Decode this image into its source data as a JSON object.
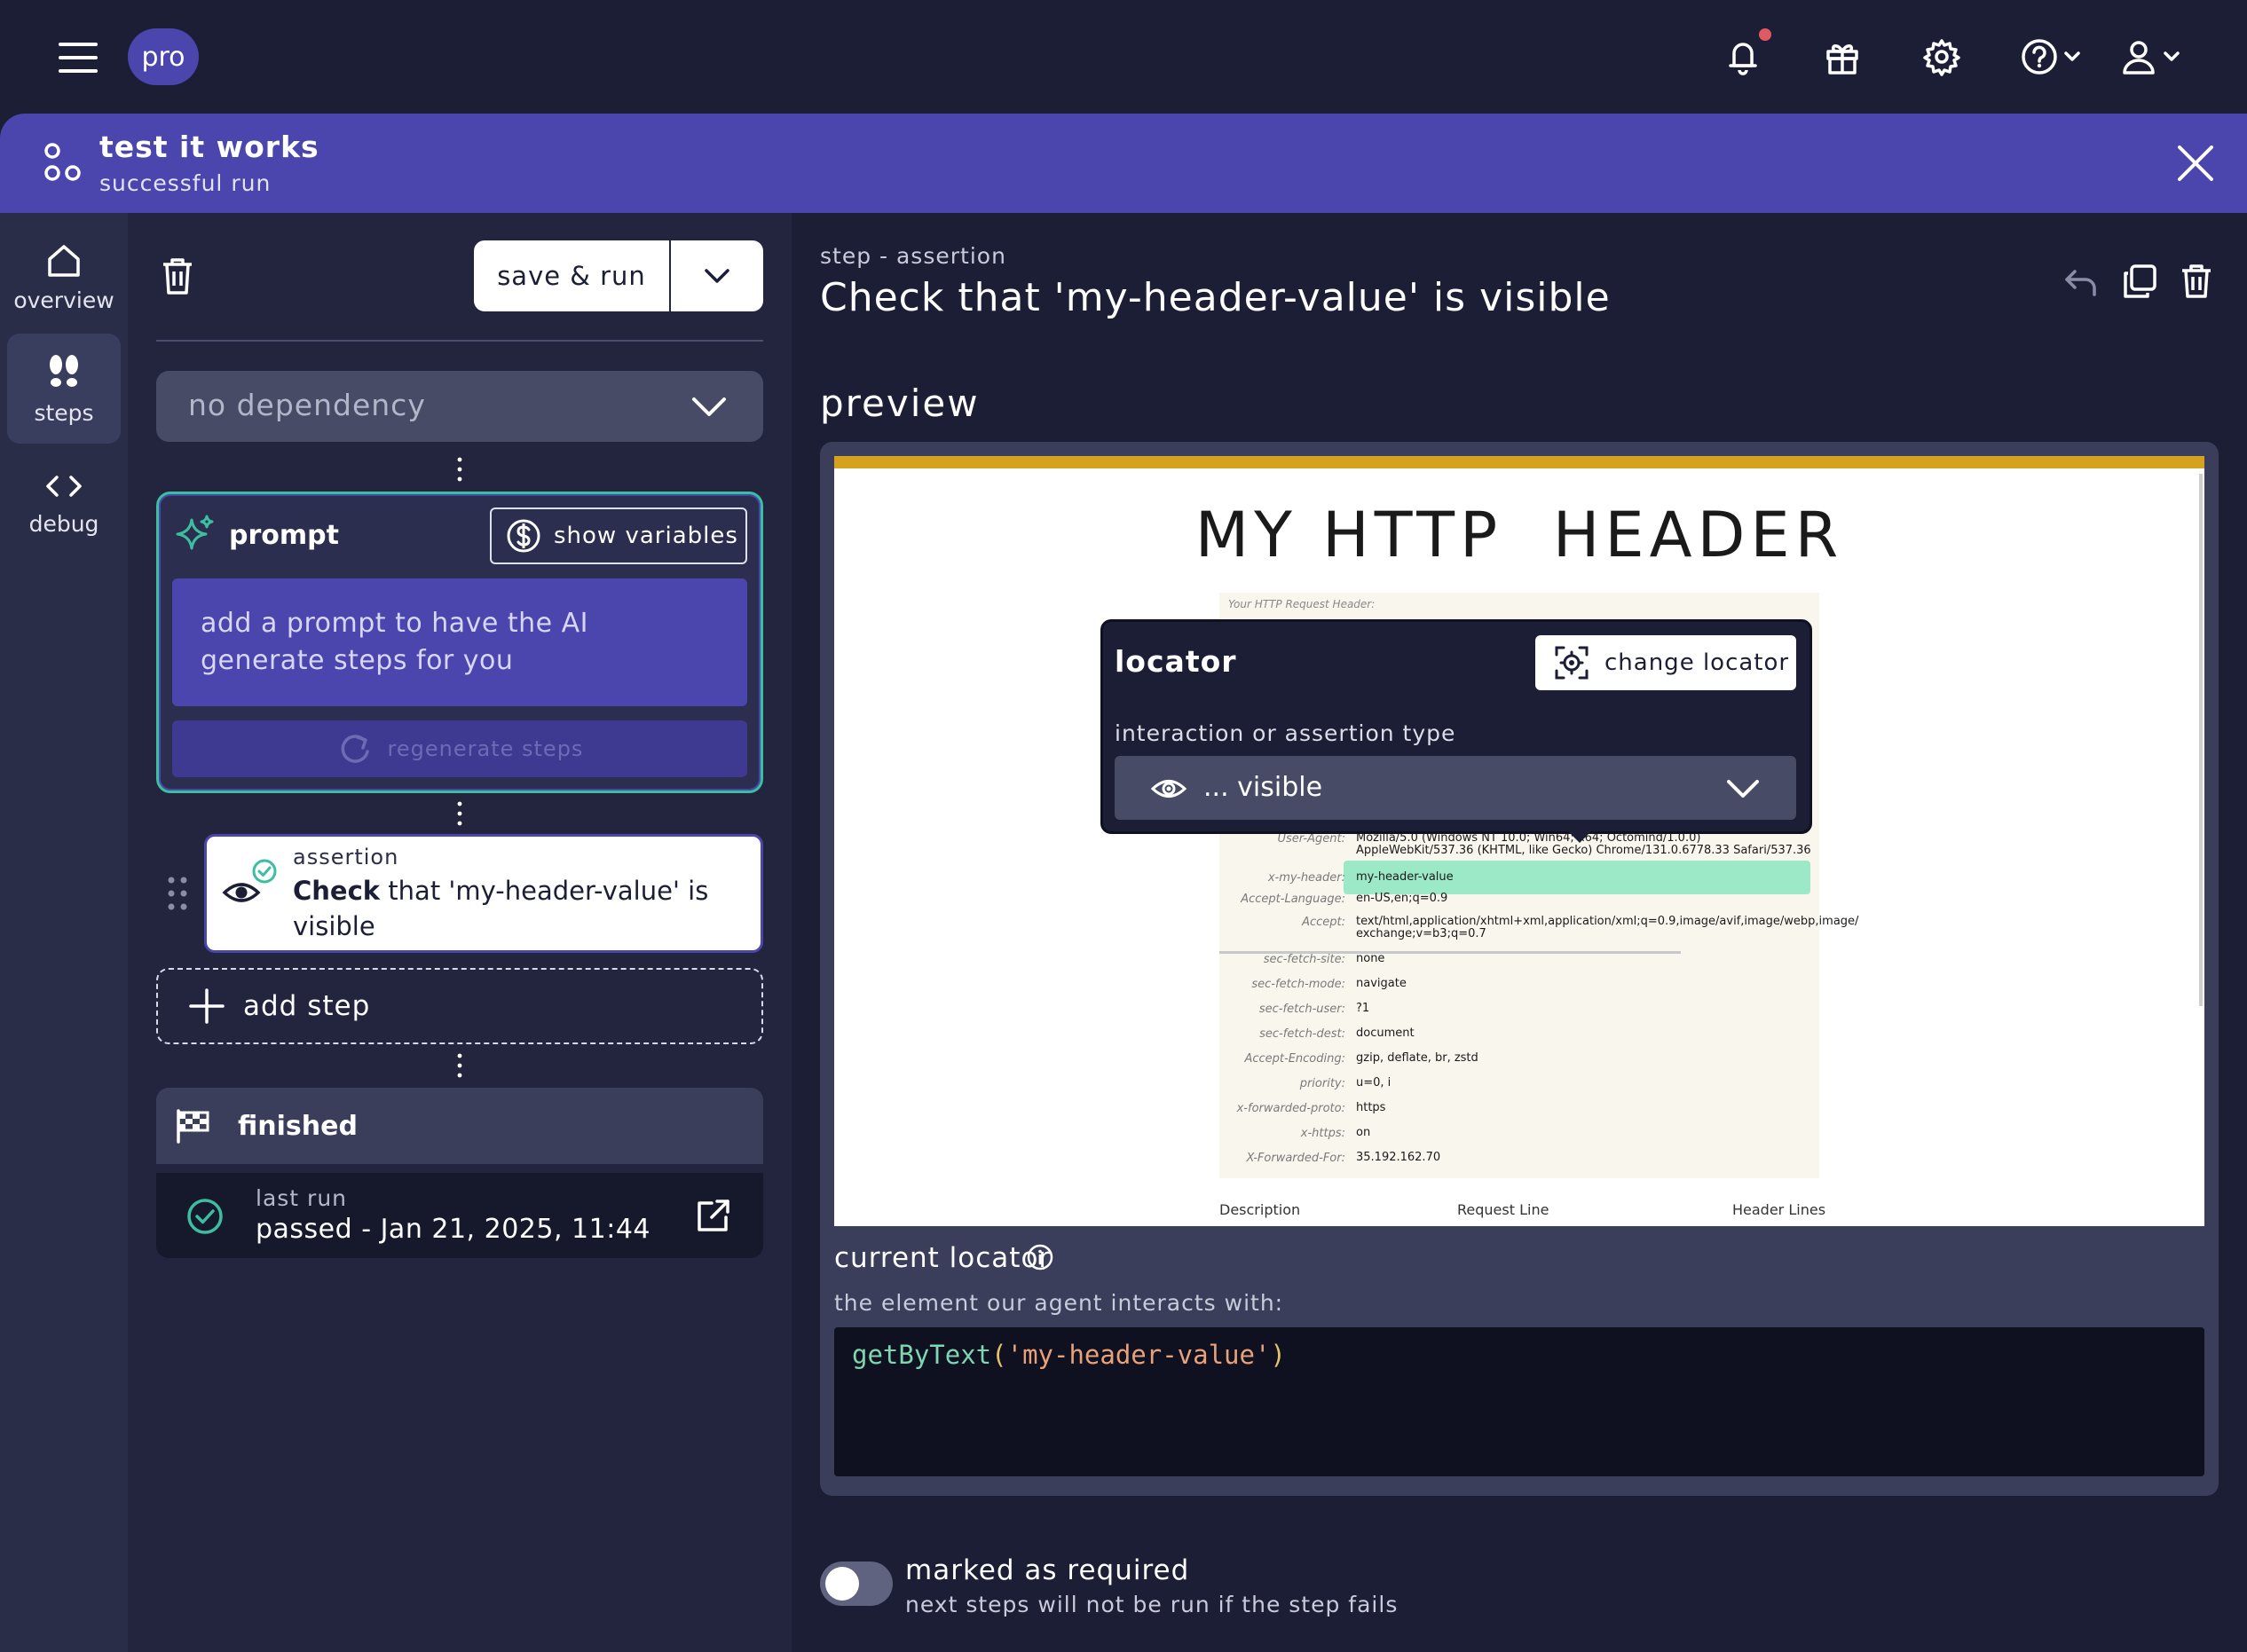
{
  "topbar": {
    "plan_badge": "pro",
    "icons": [
      "menu-icon",
      "bell-icon",
      "gift-icon",
      "gear-icon",
      "help-icon",
      "user-icon"
    ]
  },
  "banner": {
    "title": "test it works",
    "subtitle": "successful run"
  },
  "rail": {
    "items": [
      {
        "label": "overview",
        "icon": "home-icon"
      },
      {
        "label": "steps",
        "icon": "footsteps-icon"
      },
      {
        "label": "debug",
        "icon": "code-icon"
      }
    ],
    "active": "steps"
  },
  "steps_panel": {
    "save_run_label": "save & run",
    "dependency_label": "no dependency",
    "prompt": {
      "title": "prompt",
      "show_variables_label": "show variables",
      "placeholder": "add a prompt to have the AI generate steps for you",
      "regenerate_label": "regenerate steps"
    },
    "step": {
      "type": "assertion",
      "action_bold": "Check",
      "action_rest": " that 'my-header-value' is visible"
    },
    "add_step_label": "add step",
    "finished_label": "finished",
    "last_run": {
      "label": "last run",
      "value": "passed - Jan 21, 2025, 11:44"
    }
  },
  "detail": {
    "breadcrumb": "step - assertion",
    "heading": "Check that 'my-header-value' is visible",
    "preview_heading": "preview",
    "screenshot": {
      "title": "MY HTTP  HEADER",
      "caption": "Your HTTP Request Header:",
      "headers": [
        {
          "key": "User-Agent:",
          "value": "Mozilla/5.0 (Windows NT 10.0; Win64; x64; Octomind/1.0.0) AppleWebKit/537.36 (KHTML, like Gecko) Chrome/131.0.6778.33 Safari/537.36"
        },
        {
          "key": "x-my-header:",
          "value": "my-header-value"
        },
        {
          "key": "Accept-Language:",
          "value": "en-US,en;q=0.9"
        },
        {
          "key": "Accept:",
          "value": "text/html,application/xhtml+xml,application/xml;q=0.9,image/avif,image/webp,image/ exchange;v=b3;q=0.7"
        },
        {
          "key": "sec-fetch-site:",
          "value": "none"
        },
        {
          "key": "sec-fetch-mode:",
          "value": "navigate"
        },
        {
          "key": "sec-fetch-user:",
          "value": "?1"
        },
        {
          "key": "sec-fetch-dest:",
          "value": "document"
        },
        {
          "key": "Accept-Encoding:",
          "value": "gzip, deflate, br, zstd"
        },
        {
          "key": "priority:",
          "value": "u=0, i"
        },
        {
          "key": "x-forwarded-proto:",
          "value": "https"
        },
        {
          "key": "x-https:",
          "value": "on"
        },
        {
          "key": "X-Forwarded-For:",
          "value": "35.192.162.70"
        }
      ],
      "footer": [
        "Description",
        "Request Line",
        "Header Lines"
      ],
      "highlight_color": "#9ce9c7",
      "accent_bar_color": "#d4a21e"
    },
    "locator_popover": {
      "title": "locator",
      "change_label": "change locator",
      "type_label": "interaction or assertion type",
      "type_value": "... visible"
    },
    "current_locator": {
      "title": "current locator",
      "description": "the element our agent interacts with:",
      "code_fn": "getByText",
      "code_open": "(",
      "code_arg": "'my-header-value'",
      "code_close": ")"
    },
    "required": {
      "label": "marked as required",
      "sublabel": "next steps will not be run if the step fails",
      "enabled": false
    }
  },
  "colors": {
    "brand": "#4b46ad",
    "success": "#3bbfa0",
    "background": "#1c1e36"
  }
}
